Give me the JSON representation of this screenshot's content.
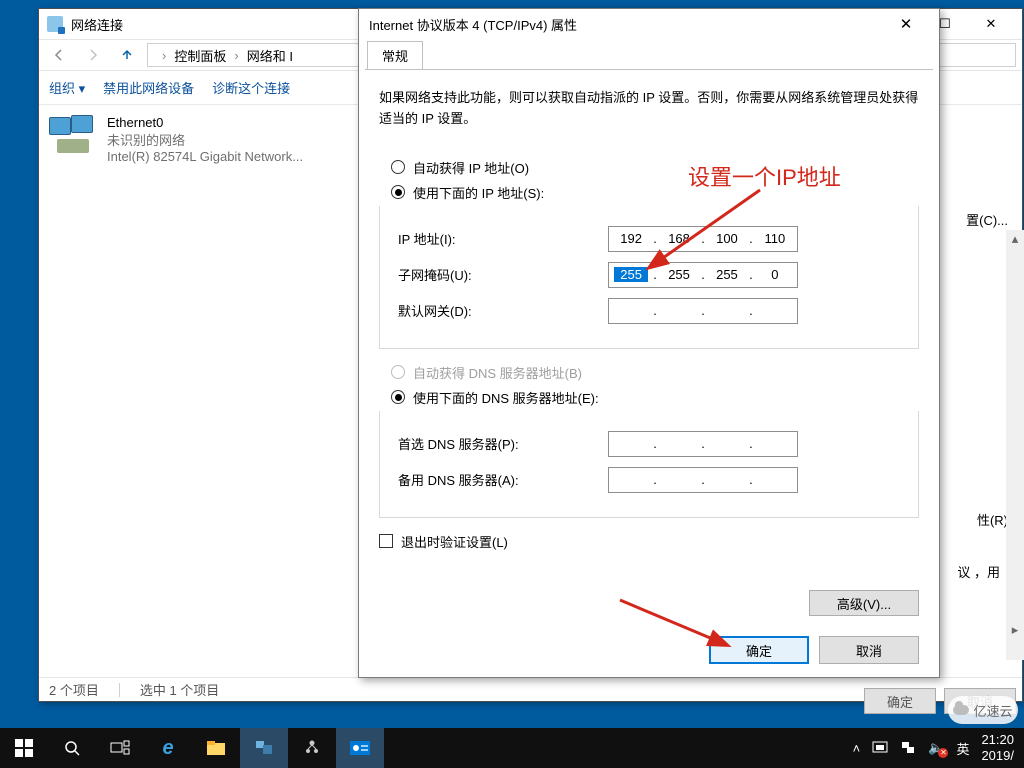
{
  "nc_window": {
    "title": "网络连接",
    "breadcrumb": {
      "root": "控制面板",
      "next": "网络和 I"
    },
    "cmd_organize": "组织 ▾",
    "cmd_disable": "禁用此网络设备",
    "cmd_diagnose": "诊断这个连接",
    "adapter": {
      "name": "Ethernet0",
      "status": "未识别的网络",
      "driver": "Intel(R) 82574L Gigabit Network..."
    },
    "status_items": "2 个项目",
    "status_selected": "选中 1 个项目"
  },
  "right_peek": {
    "config": "置(C)...",
    "props": "性(R)",
    "hint": "议 ，用",
    "ok": "确定",
    "cancel": "取消"
  },
  "dialog": {
    "title": "Internet 协议版本 4 (TCP/IPv4) 属性",
    "tab_general": "常规",
    "desc": "如果网络支持此功能，则可以获取自动指派的 IP 设置。否则，你需要从网络系统管理员处获得适当的 IP 设置。",
    "r_auto_ip": "自动获得 IP 地址(O)",
    "r_use_ip": "使用下面的 IP 地址(S):",
    "lbl_ip": "IP 地址(I):",
    "lbl_mask": "子网掩码(U):",
    "lbl_gw": "默认网关(D):",
    "ip": {
      "o1": "192",
      "o2": "168",
      "o3": "100",
      "o4": "110"
    },
    "mask": {
      "o1": "255",
      "o2": "255",
      "o3": "255",
      "o4": "0"
    },
    "r_auto_dns": "自动获得 DNS 服务器地址(B)",
    "r_use_dns": "使用下面的 DNS 服务器地址(E):",
    "lbl_dns1": "首选 DNS 服务器(P):",
    "lbl_dns2": "备用 DNS 服务器(A):",
    "chk_validate": "退出时验证设置(L)",
    "btn_advanced": "高级(V)...",
    "btn_ok": "确定",
    "btn_cancel": "取消"
  },
  "annotation": "设置一个IP地址",
  "taskbar": {
    "ime": "英",
    "time": "21:20",
    "date": "2019/"
  },
  "watermark": "亿速云"
}
